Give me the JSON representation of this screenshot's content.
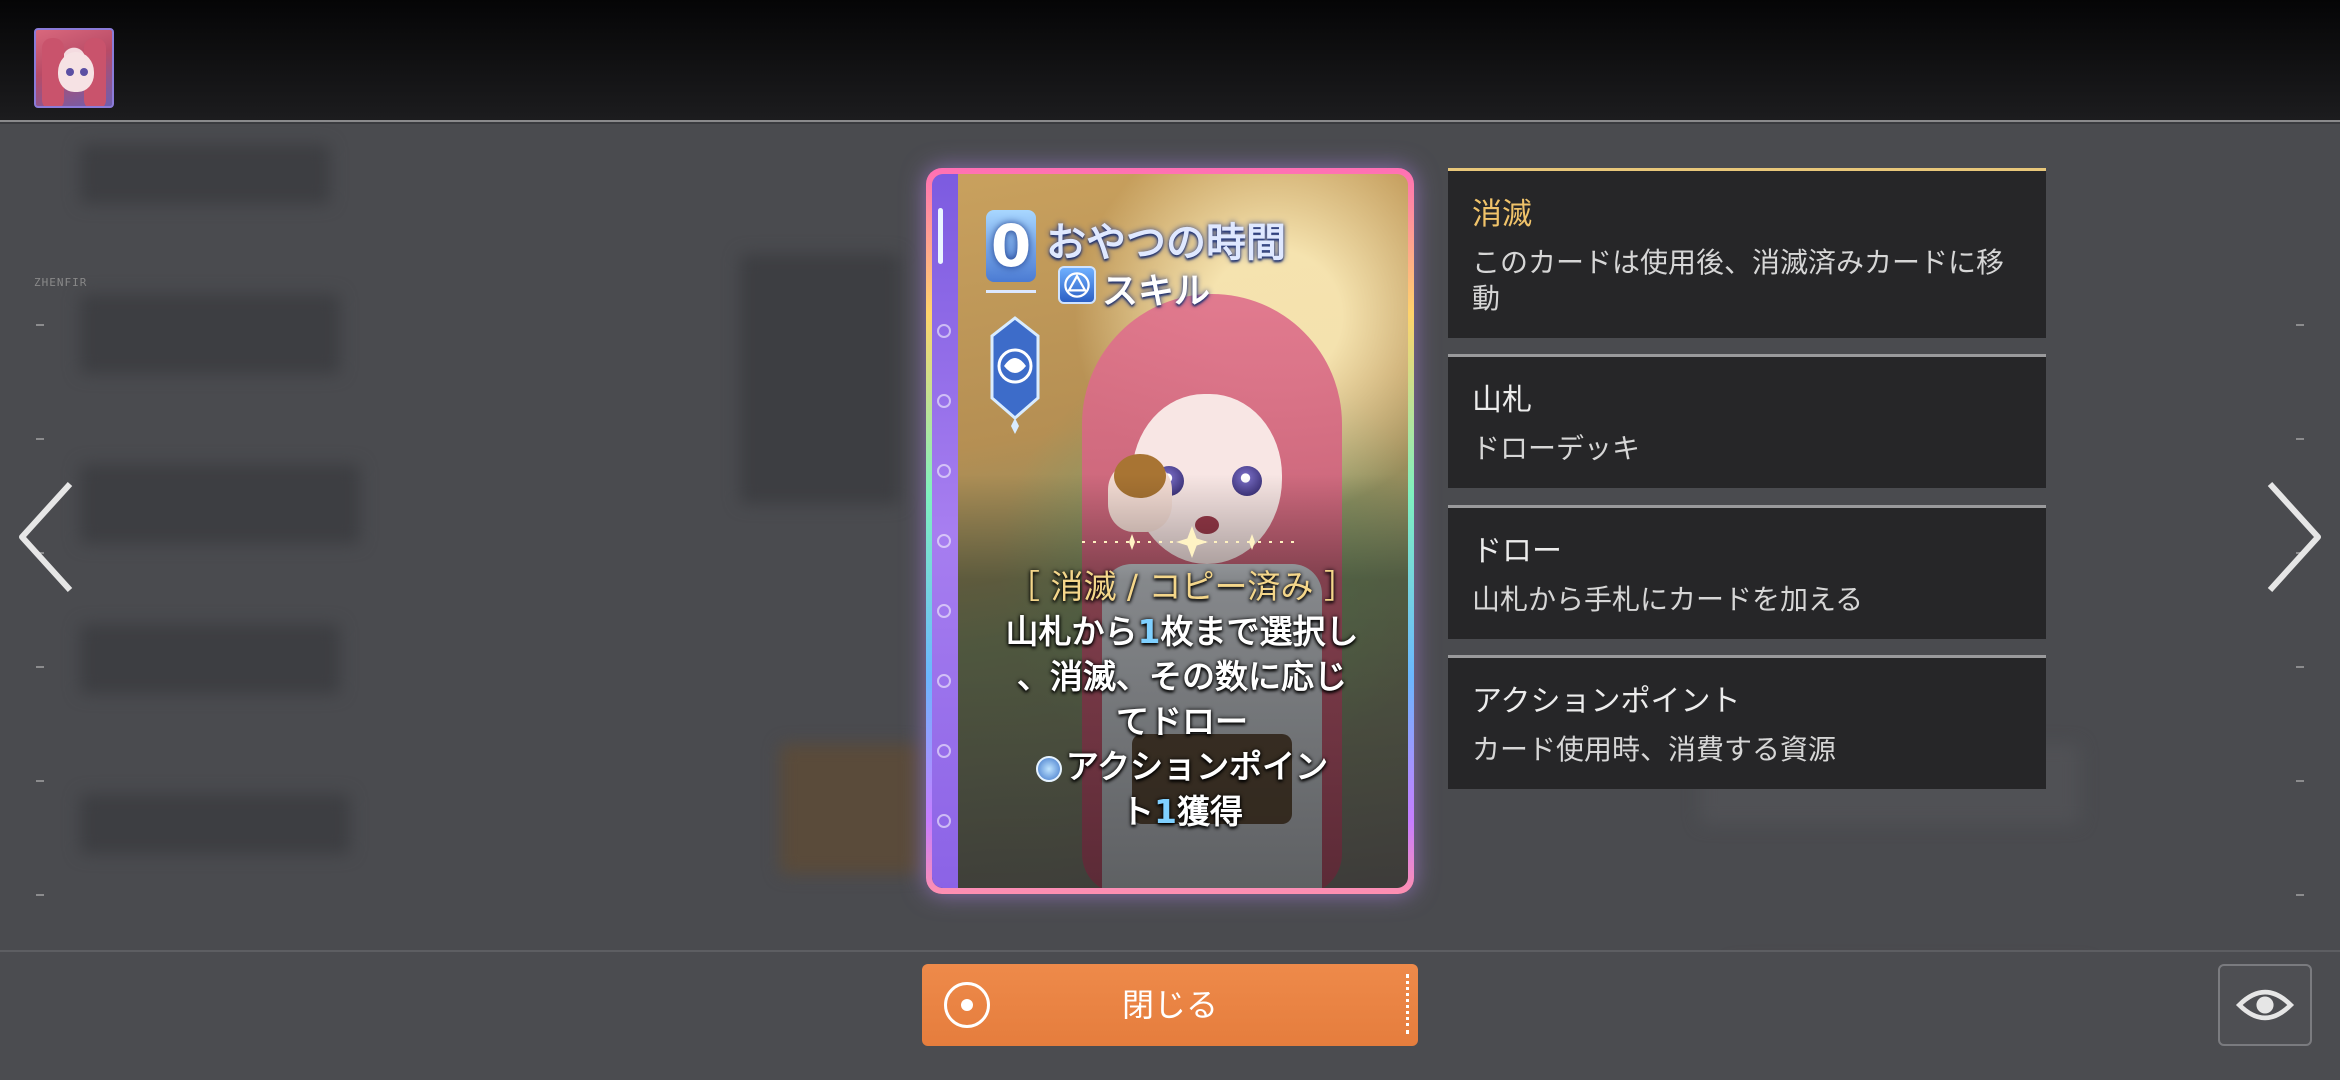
{
  "background_label": "ZHENFIR",
  "card": {
    "cost": "0",
    "title": "おやつの時間",
    "type": "スキル",
    "effect_keyword": "［ 消滅 / コピー済み ］",
    "effect_line1_pre": "山札から",
    "effect_line1_num": "1",
    "effect_line1_post": "枚まで選択し",
    "effect_line2": "、消滅、その数に応じ",
    "effect_line3": "てドロー",
    "effect_line4": "アクションポイン",
    "effect_line5_pre": "ト",
    "effect_line5_num": "1",
    "effect_line5_post": "獲得"
  },
  "keywords": [
    {
      "name": "消滅",
      "desc": "このカードは使用後、消滅済みカードに移動"
    },
    {
      "name": "山札",
      "desc": "ドローデッキ"
    },
    {
      "name": "ドロー",
      "desc": "山札から手札にカードを加える"
    },
    {
      "name": "アクションポイント",
      "desc": "カード使用時、消費する資源"
    }
  ],
  "buttons": {
    "close_label": "閉じる"
  },
  "icons": {
    "prev": "chevron-left-icon",
    "next": "chevron-right-icon",
    "view": "eye-icon",
    "confirm": "circle-dot-icon"
  },
  "colors": {
    "accent_orange": "#e8823f",
    "keyword_gold": "#f0c36a",
    "panel_bg": "#262628"
  }
}
